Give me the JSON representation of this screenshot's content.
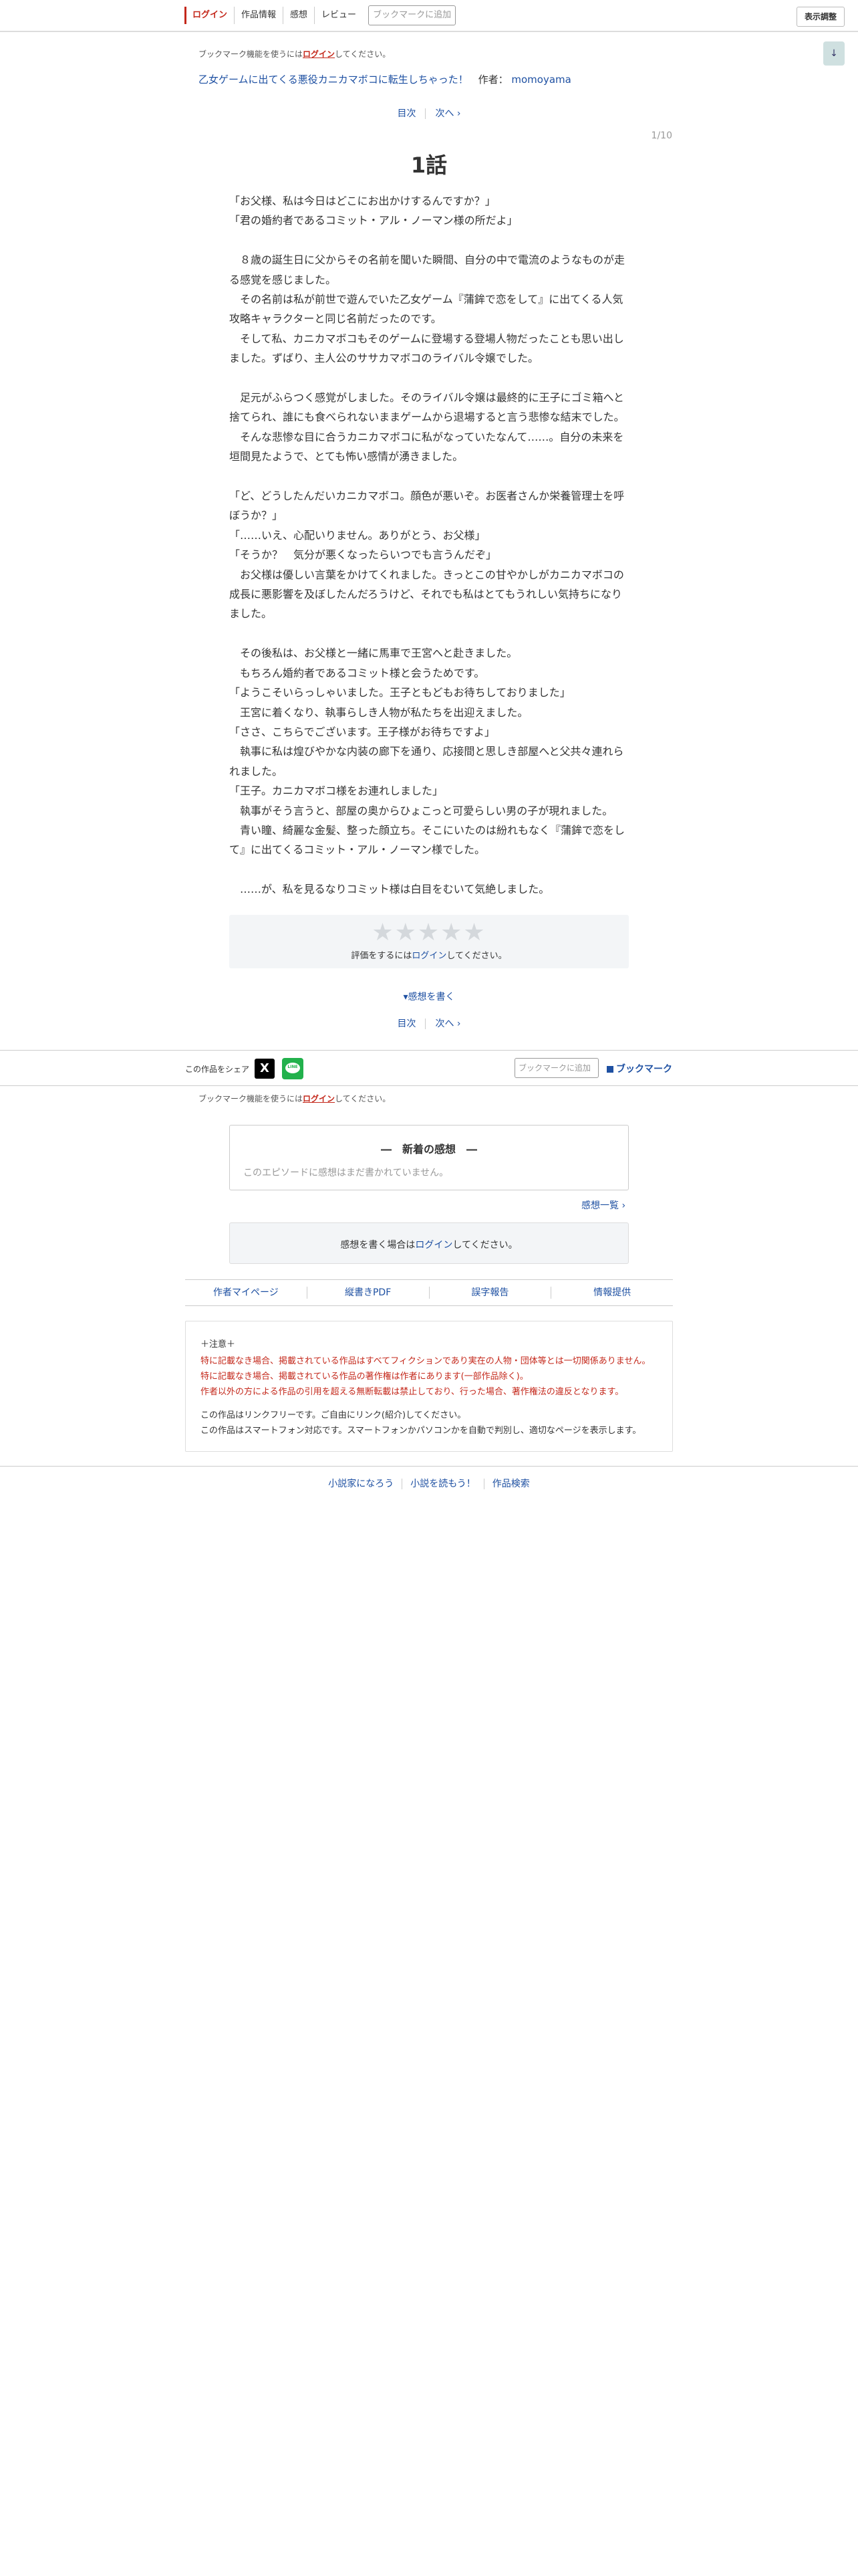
{
  "topnav": {
    "login": "ログイン",
    "work_info": "作品情報",
    "impressions": "感想",
    "review": "レビュー",
    "bookmark_add": "ブックマークに追加",
    "display_adjust": "表示調整"
  },
  "scroll_down": "↓",
  "bookmark_notice": {
    "prefix": "ブックマーク機能を使うには",
    "link": "ログイン",
    "suffix": "してください。"
  },
  "series": {
    "title": "乙女ゲームに出てくる悪役カニカマボコに転生しちゃった！",
    "author_label": "作者：",
    "author": "momoyama"
  },
  "pager": {
    "toc": "目次",
    "next": "次へ ›"
  },
  "page_count": "1/10",
  "episode_title": "1話",
  "novel_paragraphs": [
    "「お父様、私は今日はどこにお出かけするんですか？」\n「君の婚約者であるコミット・アル・ノーマン様の所だよ」",
    "",
    "　８歳の誕生日に父からその名前を聞いた瞬間、自分の中で電流のようなものが走る感覚を感じました。\n　その名前は私が前世で遊んでいた乙女ゲーム『蒲鉾で恋をして』に出てくる人気攻略キャラクターと同じ名前だったのです。\n　そして私、カニカマボコもそのゲームに登場する登場人物だったことも思い出しました。ずばり、主人公のササカマボコのライバル令嬢でした。",
    "",
    "　足元がふらつく感覚がしました。そのライバル令嬢は最終的に王子にゴミ箱へと捨てられ、誰にも食べられないままゲームから退場すると言う悲惨な結末でした。\n　そんな悲惨な目に合うカニカマボコに私がなっていたなんて……。自分の未来を垣間見たようで、とても怖い感情が湧きました。",
    "",
    "「ど、どうしたんだいカニカマボコ。顔色が悪いぞ。お医者さんか栄養管理士を呼ぼうか？」\n「……いえ、心配いりません。ありがとう、お父様」\n「そうか？　気分が悪くなったらいつでも言うんだぞ」\n　お父様は優しい言葉をかけてくれました。きっとこの甘やかしがカニカマボコの成長に悪影響を及ぼしたんだろうけど、それでも私はとてもうれしい気持ちになりました。",
    "",
    "　その後私は、お父様と一緒に馬車で王宮へと赴きました。\n　もちろん婚約者であるコミット様と会うためです。\n「ようこそいらっしゃいました。王子ともどもお待ちしておりました」\n　王宮に着くなり、執事らしき人物が私たちを出迎えました。\n「ささ、こちらでございます。王子様がお待ちですよ」\n　執事に私は煌びやかな内装の廊下を通り、応接間と思しき部屋へと父共々連れられました。\n「王子。カニカマボコ様をお連れしました」\n　執事がそう言うと、部屋の奥からひょこっと可愛らしい男の子が現れました。\n　青い瞳、綺麗な金髪、整った顔立ち。そこにいたのは紛れもなく『蒲鉾で恋をして』に出てくるコミット・アル・ノーマン様でした。",
    "",
    "　……が、私を見るなりコミット様は白目をむいて気絶しました。"
  ],
  "rating": {
    "stars": "★★★★★",
    "prefix": "評価をするには",
    "link": "ログイン",
    "suffix": "してください。"
  },
  "write_impression": "▾感想を書く",
  "share": {
    "label": "この作品をシェア",
    "x_icon": "X",
    "line_icon": "LINE",
    "bookmark_add": "ブックマークに追加",
    "bookmark_btn": "ブックマーク"
  },
  "impressions_box": {
    "heading": "―　新着の感想　―",
    "empty": "このエピソードに感想はまだ書かれていません。",
    "list_link": "感想一覧 ›"
  },
  "write_login": {
    "prefix": "感想を書く場合は",
    "link": "ログイン",
    "suffix": "してください。"
  },
  "links": {
    "author_page": "作者マイページ",
    "pdf": "縦書きPDF",
    "typo_report": "誤字報告",
    "info": "情報提供"
  },
  "caution": {
    "title": "＋注意＋",
    "red_lines": [
      "特に記載なき場合、掲載されている作品はすべてフィクションであり実在の人物・団体等とは一切関係ありません。",
      "特に記載なき場合、掲載されている作品の著作権は作者にあります(一部作品除く)。",
      "作者以外の方による作品の引用を超える無断転載は禁止しており、行った場合、著作権法の違反となります。"
    ],
    "black_lines": [
      "この作品はリンクフリーです。ご自由にリンク(紹介)してください。",
      "この作品はスマートフォン対応です。スマートフォンかパソコンかを自動で判別し、適切なページを表示します。"
    ]
  },
  "footer": {
    "become": "小説家になろう",
    "read": "小説を読もう！",
    "search": "作品検索"
  }
}
